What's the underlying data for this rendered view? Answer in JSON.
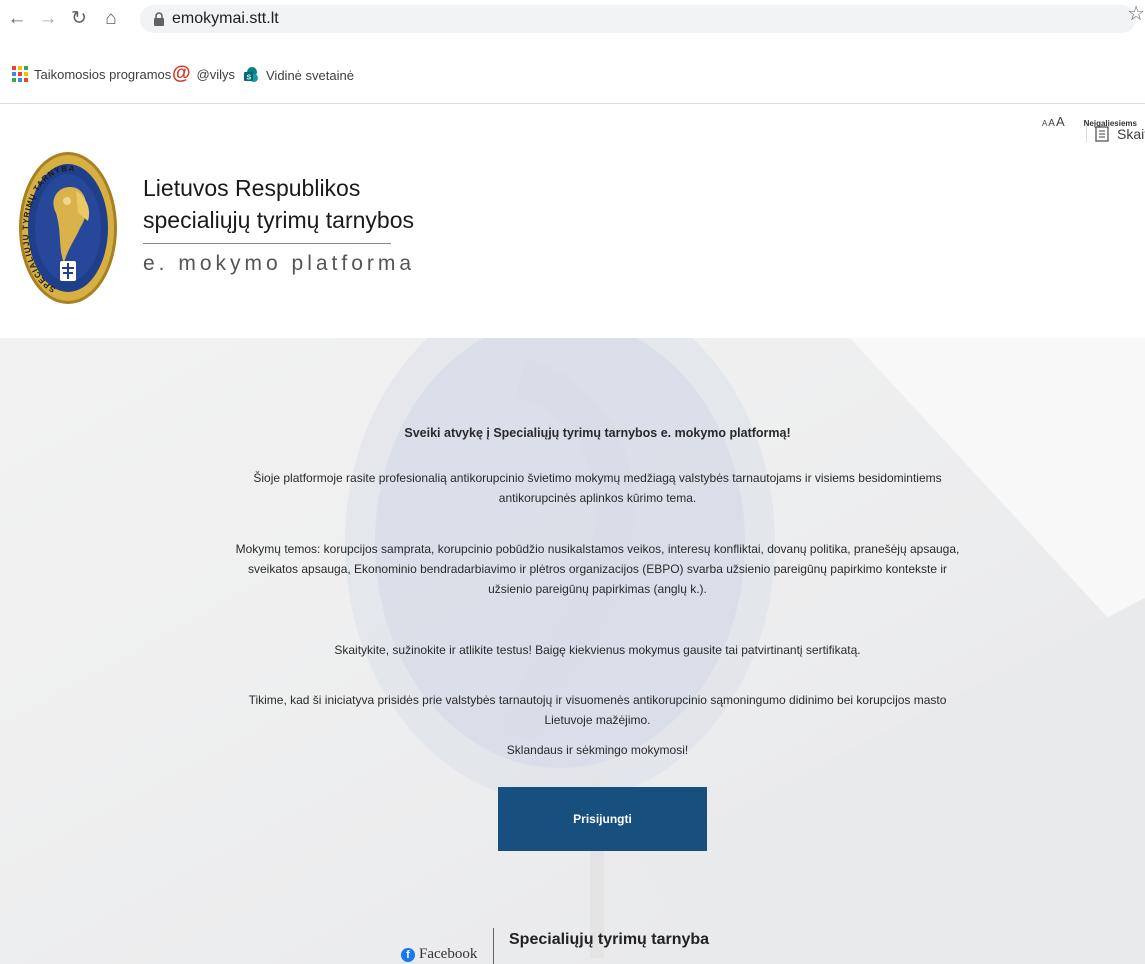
{
  "browser": {
    "url": "emokymai.stt.lt",
    "bookmarks": [
      {
        "label": "Taikomosios programos",
        "icon": "apps-grid-icon"
      },
      {
        "label": "@vilys",
        "icon": "at-icon"
      },
      {
        "label": "Vidinė svetainė",
        "icon": "sharepoint-icon"
      }
    ],
    "reading_list_label": "Skait"
  },
  "header": {
    "font_size_label": "AAA",
    "accessibility_link": "Neįgaliesiems",
    "brand_line1": "Lietuvos Respublikos",
    "brand_line2": "specialiųjų tyrimų tarnybos",
    "brand_sub": "e. mokymo platforma",
    "logo_text": "SPECIALIŲJŲ TYRIMŲ TARNYBA"
  },
  "hero": {
    "welcome": "Sveiki atvykę į Specialiųjų tyrimų tarnybos e. mokymo platformą!",
    "p1": "Šioje platformoje rasite profesionalią antikorupcinio švietimo mokymų medžiagą valstybės tarnautojams ir visiems besidomintiems antikorupcinės aplinkos kūrimo tema.",
    "p2": "Mokymų temos: korupcijos samprata, korupcinio pobūdžio nusikalstamos veikos, interesų konfliktai, dovanų politika, pranešėjų apsauga, sveikatos apsauga, Ekonominio bendradarbiavimo ir plėtros organizacijos (EBPO) svarba užsienio pareigūnų papirkimo kontekste ir užsienio pareigūnų papirkimas (anglų k.).",
    "p3": "Skaitykite, sužinokite ir atlikite testus! Baigę kiekvienus mokymus gausite tai patvirtinantį sertifikatą.",
    "p4": "Tikime, kad ši iniciatyva prisidės prie valstybės tarnautojų ir visuomenės antikorupcinio sąmoningumo didinimo bei korupcijos masto Lietuvoje mažėjimo.",
    "p5": "Sklandaus ir sėkmingo mokymosi!",
    "login_button": "Prisijungti"
  },
  "footer": {
    "facebook_label": "Facebook",
    "org_name": "Specialiųjų tyrimų tarnyba"
  },
  "colors": {
    "button_blue": "#17507e",
    "hero_bg": "#e9e9ea",
    "logo_blue": "#1f3f8a",
    "logo_gold": "#c99a2e"
  }
}
